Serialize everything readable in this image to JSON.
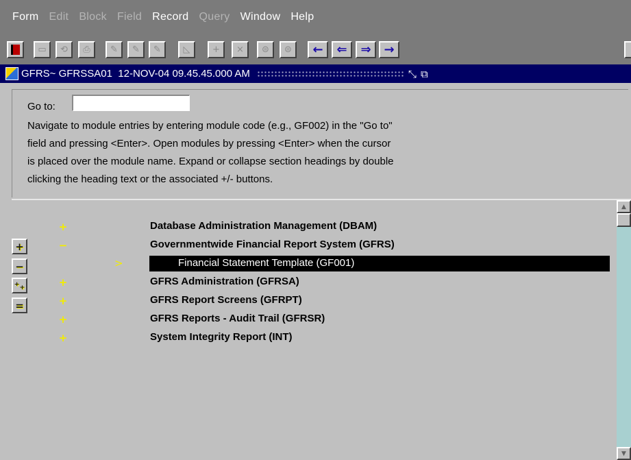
{
  "menu": [
    "Form",
    "Edit",
    "Block",
    "Field",
    "Record",
    "Query",
    "Window",
    "Help"
  ],
  "menu_disabled": [
    false,
    true,
    true,
    true,
    false,
    true,
    false,
    false
  ],
  "toolbar": {
    "buttons": [
      {
        "name": "exit-button",
        "icon": "door-exit-icon",
        "glyph": ""
      },
      {
        "name": "save-button",
        "icon": "save-icon",
        "glyph": "▭"
      },
      {
        "name": "revert-button",
        "icon": "revert-icon",
        "glyph": "⟲"
      },
      {
        "name": "print-button",
        "icon": "printer-icon",
        "glyph": "⎙"
      },
      {
        "name": "clear-form-button",
        "icon": "clear-form-icon",
        "glyph": "✎"
      },
      {
        "name": "clear-block-button",
        "icon": "clear-block-icon",
        "glyph": "✎"
      },
      {
        "name": "clear-record-button",
        "icon": "clear-record-icon",
        "glyph": "✎"
      },
      {
        "name": "clear-field-button",
        "icon": "eraser-icon",
        "glyph": "◺"
      },
      {
        "name": "insert-record-button",
        "icon": "plus-icon",
        "glyph": "+"
      },
      {
        "name": "delete-record-button",
        "icon": "x-icon",
        "glyph": "×"
      },
      {
        "name": "enter-query-button",
        "icon": "query-icon",
        "glyph": "⊜"
      },
      {
        "name": "execute-query-button",
        "icon": "execute-query-icon",
        "glyph": "⊜"
      },
      {
        "name": "previous-block-button",
        "icon": "arrow-left-icon",
        "glyph": "←"
      },
      {
        "name": "previous-record-button",
        "icon": "arrow-left-bold-icon",
        "glyph": "⇐"
      },
      {
        "name": "next-record-button",
        "icon": "arrow-right-bold-icon",
        "glyph": "⇒"
      },
      {
        "name": "next-block-button",
        "icon": "arrow-right-icon",
        "glyph": "→"
      }
    ]
  },
  "window": {
    "title": "GFRS~ GFRSSA01  12-NOV-04 09.45.45.000 AM",
    "minimize_glyph": "⤡",
    "restore_glyph": "⧉"
  },
  "goto": {
    "label": "Go to:",
    "value": ""
  },
  "help_lines": [
    "Navigate to module entries by entering module code (e.g., GF002) in the \"Go to\"",
    "field and pressing <Enter>.  Open modules by pressing <Enter> when the cursor",
    "is placed over the module name.  Expand or collapse section headings by double",
    "clicking the heading text or the associated +/- buttons."
  ],
  "tree": [
    {
      "mark": "+",
      "label": "Database Administration Management  (DBAM)",
      "selected": false
    },
    {
      "mark": "−",
      "label": "Governmentwide Financial Report System  (GFRS)",
      "selected": false
    },
    {
      "mark": ">",
      "label": "Financial Statement Template  (GF001)",
      "selected": true
    },
    {
      "mark": "+",
      "label": "GFRS Administration  (GFRSA)",
      "selected": false
    },
    {
      "mark": "+",
      "label": "GFRS Report Screens  (GFRPT)",
      "selected": false
    },
    {
      "mark": "+",
      "label": "GFRS Reports - Audit Trail  (GFRSR)",
      "selected": false
    },
    {
      "mark": "+",
      "label": "System Integrity Report  (INT)",
      "selected": false
    }
  ],
  "side_buttons": [
    {
      "name": "expand-button",
      "icon": "expand-plus-icon",
      "glyph": "+"
    },
    {
      "name": "collapse-button",
      "icon": "collapse-minus-icon",
      "glyph": "−"
    },
    {
      "name": "expand-all-button",
      "icon": "expand-all-icon",
      "glyph": "⁺₊"
    },
    {
      "name": "collapse-all-button",
      "icon": "collapse-all-icon",
      "glyph": "="
    }
  ],
  "colors": {
    "title_bar": "#000063",
    "selection": "#000000",
    "tree_marks": "#f2ec00",
    "nav_arrows": "#1a0aa8",
    "face": "#c0c0c0",
    "menubar": "#7b7b7b"
  }
}
